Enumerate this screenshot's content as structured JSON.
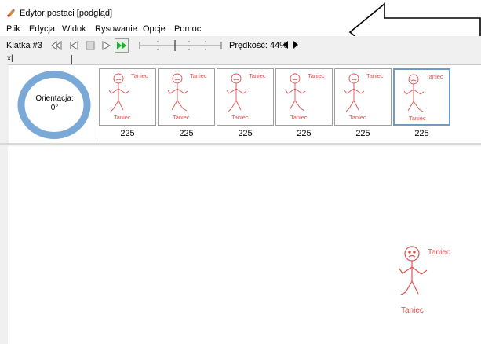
{
  "window": {
    "title": "Edytor postaci [podgląd]"
  },
  "menu": [
    "Plik",
    "Edycja",
    "Widok",
    "Rysowanie",
    "Opcje",
    "Pomoc"
  ],
  "toolbar": {
    "frame_label": "Klatka #3",
    "speed_label": "Prędkość: 44%"
  },
  "subbar": {
    "close_glyph": "x|"
  },
  "orientation": {
    "label": "Orientacja:",
    "value": "0°"
  },
  "frames": [
    {
      "name": "Taniec",
      "caption": "Taniec",
      "count": "225"
    },
    {
      "name": "Taniec",
      "caption": "Taniec",
      "count": "225"
    },
    {
      "name": "Taniec",
      "caption": "Taniec",
      "count": "225"
    },
    {
      "name": "Taniec",
      "caption": "Taniec",
      "count": "225"
    },
    {
      "name": "Taniec",
      "caption": "Taniec",
      "count": "225"
    },
    {
      "name": "Taniec",
      "caption": "Taniec",
      "count": "225"
    }
  ],
  "selected_frame": 6,
  "canvas": {
    "name": "Taniec",
    "caption": "Taniec"
  },
  "colors": {
    "figure": "#e05050",
    "ring": "#7aa9d8",
    "play_green": "#1fae2f",
    "selection": "#6f9bc9"
  }
}
